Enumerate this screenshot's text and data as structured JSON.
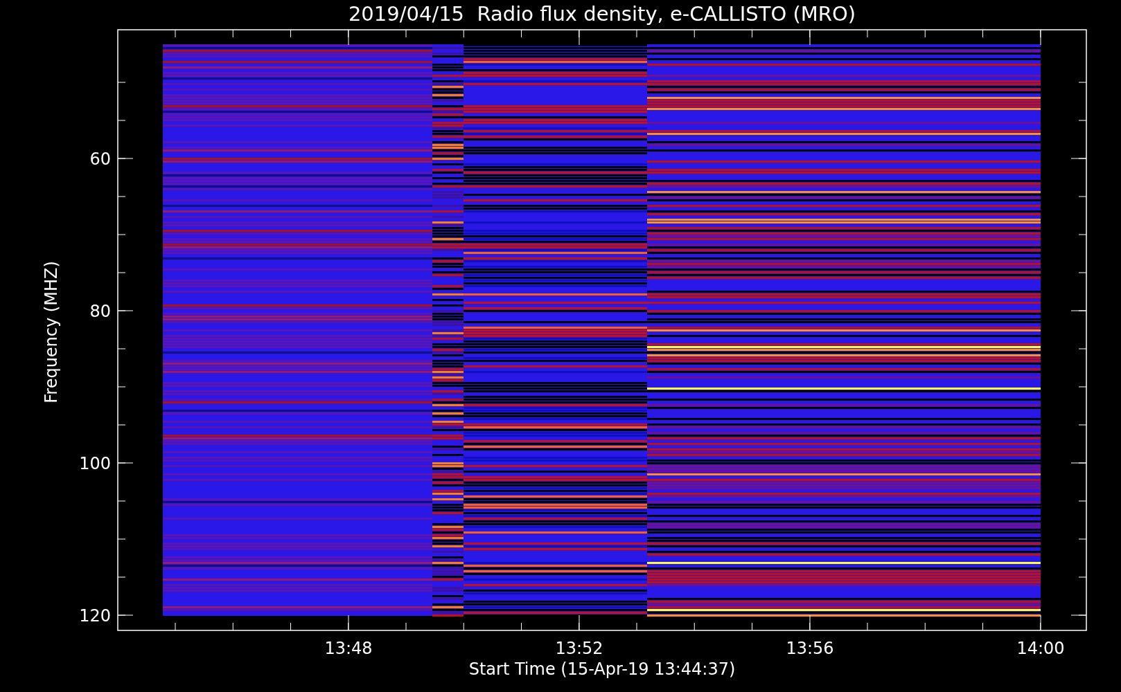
{
  "plot": {
    "title": "2019/04/15  Radio flux density, e-CALLISTO (MRO)",
    "xlabel": "Start Time (15-Apr-19 13:44:37)",
    "ylabel": "Frequency (MHZ)",
    "xticks": [
      "13:48",
      "13:52",
      "13:56",
      "14:00"
    ],
    "yticks": [
      "60",
      "80",
      "100",
      "120"
    ]
  }
}
